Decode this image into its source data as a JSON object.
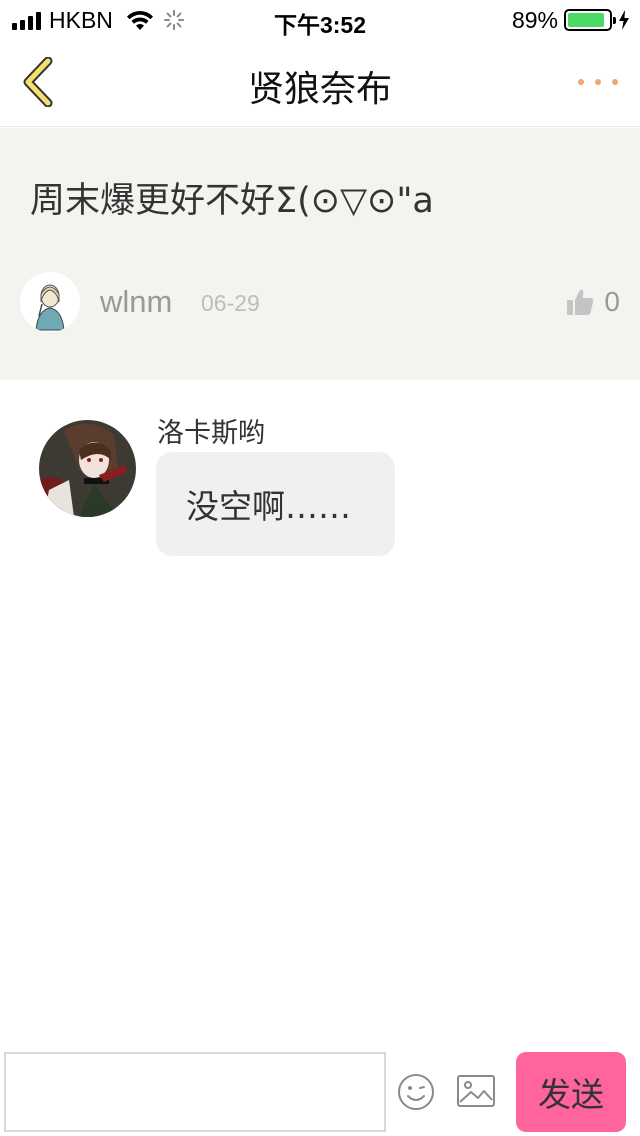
{
  "status_bar": {
    "carrier": "HKBN",
    "time": "下午3:52",
    "battery_percent": "89%",
    "battery_level": 0.89,
    "icons": [
      "signal-icon",
      "wifi-icon",
      "activity-spinner-icon",
      "battery-icon",
      "charging-bolt-icon"
    ]
  },
  "nav": {
    "back_icon": "chevron-left-icon",
    "title": "贤狼奈布",
    "more_icon": "more-dots-icon",
    "accent_color": "#f0a66e",
    "back_color": "#f5e06e"
  },
  "post": {
    "title": "周末爆更好不好Σ(⊙▽⊙\"a",
    "author": "wlnm",
    "date": "06-29",
    "like_icon": "thumbs-up-icon",
    "likes": "0",
    "background": "#f3f3ef"
  },
  "comments": [
    {
      "name": "洛卡斯哟",
      "text": "没空啊……"
    }
  ],
  "composer": {
    "input_value": "",
    "emoji_icon": "emoji-icon",
    "image_icon": "image-icon",
    "send_label": "发送",
    "send_color": "#ff649c"
  }
}
